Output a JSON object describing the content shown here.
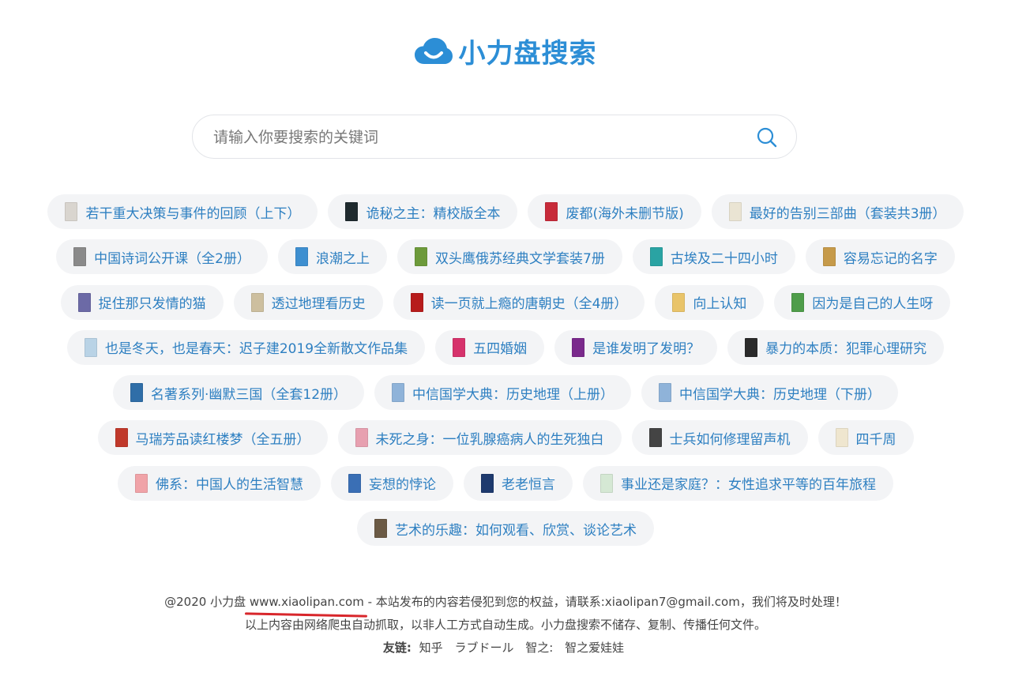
{
  "logo": {
    "text": "小力盘搜索",
    "color": "#2c8ed6"
  },
  "search": {
    "placeholder": "请输入你要搜索的关键词",
    "value": ""
  },
  "tags": [
    [
      {
        "label": "若干重大决策与事件的回顾（上下）",
        "cover": "#d9d5cf"
      },
      {
        "label": "诡秘之主：精校版全本",
        "cover": "#1f2a2e"
      },
      {
        "label": "废都(海外未删节版)",
        "cover": "#c72b3a"
      },
      {
        "label": "最好的告别三部曲（套装共3册）",
        "cover": "#eae4d3"
      }
    ],
    [
      {
        "label": "中国诗词公开课（全2册）",
        "cover": "#8a8a8a"
      },
      {
        "label": "浪潮之上",
        "cover": "#3e8fd0"
      },
      {
        "label": "双头鹰俄苏经典文学套装7册",
        "cover": "#6d9a3b"
      },
      {
        "label": "古埃及二十四小时",
        "cover": "#2aa3a3"
      },
      {
        "label": "容易忘记的名字",
        "cover": "#c69a4a"
      }
    ],
    [
      {
        "label": "捉住那只发情的猫",
        "cover": "#6c6aa6"
      },
      {
        "label": "透过地理看历史",
        "cover": "#cdbf9f"
      },
      {
        "label": "读一页就上瘾的唐朝史（全4册）",
        "cover": "#b71c1c"
      },
      {
        "label": "向上认知",
        "cover": "#e9c46a"
      },
      {
        "label": "因为是自己的人生呀",
        "cover": "#4f9d4a"
      }
    ],
    [
      {
        "label": "也是冬天，也是春天：迟子建2019全新散文作品集",
        "cover": "#b9d3e6"
      },
      {
        "label": "五四婚姻",
        "cover": "#d6336c"
      },
      {
        "label": "是谁发明了发明？",
        "cover": "#7a2a8c"
      },
      {
        "label": "暴力的本质：犯罪心理研究",
        "cover": "#2b2b2b"
      }
    ],
    [
      {
        "label": "名著系列·幽默三国（全套12册）",
        "cover": "#2f6ea8"
      },
      {
        "label": "中信国学大典：历史地理（上册）",
        "cover": "#8fb3d9"
      },
      {
        "label": "中信国学大典：历史地理（下册）",
        "cover": "#8fb3d9"
      }
    ],
    [
      {
        "label": "马瑞芳品读红楼梦（全五册）",
        "cover": "#c0392b"
      },
      {
        "label": "未死之身：一位乳腺癌病人的生死独白",
        "cover": "#e7a0b0"
      },
      {
        "label": "士兵如何修理留声机",
        "cover": "#444444"
      },
      {
        "label": "四千周",
        "cover": "#efe6cf"
      }
    ],
    [
      {
        "label": "佛系：中国人的生活智慧",
        "cover": "#f0a3a8"
      },
      {
        "label": "妄想的悖论",
        "cover": "#3a6fb5"
      },
      {
        "label": "老老恒言",
        "cover": "#1e3a6e"
      },
      {
        "label": "事业还是家庭？：女性追求平等的百年旅程",
        "cover": "#d5e8d4"
      }
    ],
    [
      {
        "label": "艺术的乐趣：如何观看、欣赏、谈论艺术",
        "cover": "#6b5a45"
      }
    ]
  ],
  "footer": {
    "copyright": "@2020 小力盘",
    "domain": "www.xiaolipan.com",
    "notice": "- 本站发布的内容若侵犯到您的权益，请联系:xiaolipan7@gmail.com，我们将及时处理！",
    "disclaimer": "以上内容由网络爬虫自动抓取，以非人工方式自动生成。小力盘搜索不储存、复制、传播任何文件。",
    "links_label": "友链:",
    "links": [
      "知乎",
      "ラブドール",
      "智之:",
      "智之爱娃娃"
    ]
  },
  "colors": {
    "accent": "#2c8ed6",
    "tag_text": "#2d7fc1",
    "tag_bg": "#f3f4f6",
    "underline": "#d8262b"
  }
}
